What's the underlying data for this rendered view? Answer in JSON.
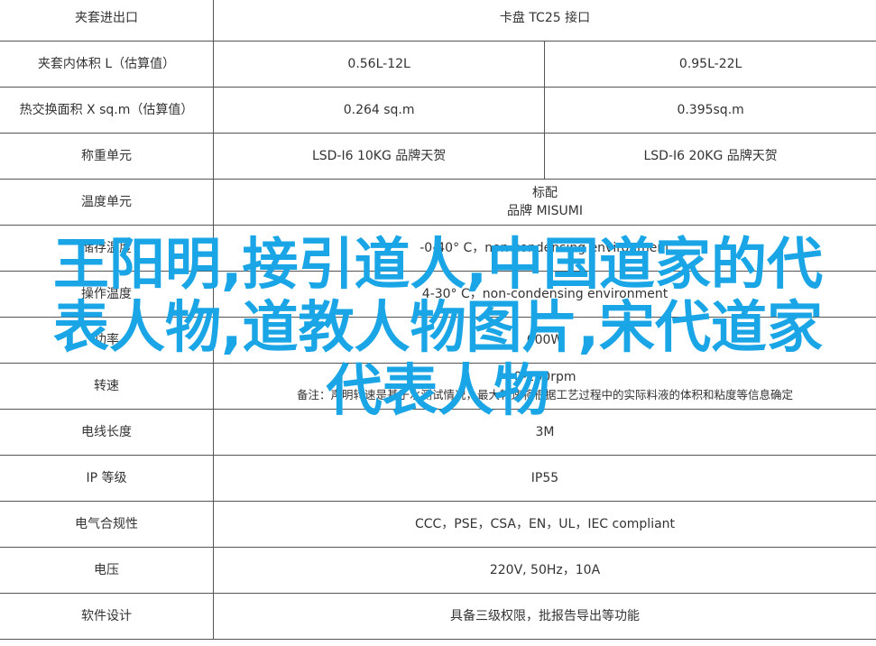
{
  "rows": [
    {
      "label": "夹套进出口",
      "value": "卡盘 TC25 接口"
    },
    {
      "label": "夹套内体积 L（估算值）",
      "col1": "0.56L-12L",
      "col2": "0.95L-22L"
    },
    {
      "label": "热交换面积 X sq.m（估算值）",
      "col1": "0.264 sq.m",
      "col2": "0.395sq.m"
    },
    {
      "label": "称重单元",
      "col1": "LSD-I6 10KG 品牌天贺",
      "col2": "LSD-I6 20KG 品牌天贺"
    },
    {
      "label": "温度单元",
      "line1": "标配",
      "line2": "品牌 MISUMI"
    },
    {
      "label": "储存温度",
      "value": "-0-40° C，non-condensing environment"
    },
    {
      "label": "操作温度",
      "value": "4-30° C，non-condensing environment"
    },
    {
      "label": "功率",
      "value": "600W"
    },
    {
      "label": "转速",
      "line1": "0-200rpm",
      "line2": "备注：声明转速是基于水测试情况，最大转速将根据工艺过程中的实际料液的体积和粘度等信息确定"
    },
    {
      "label": "电线长度",
      "value": "3M"
    },
    {
      "label": "IP 等级",
      "value": "IP55"
    },
    {
      "label": "电气合规性",
      "value": "CCC，PSE，CSA，EN，UL，IEC compliant"
    },
    {
      "label": "电压",
      "value": "220V, 50Hz，10A"
    },
    {
      "label": "软件设计",
      "value": "具备三级权限，批报告导出等功能"
    }
  ],
  "overlay": {
    "line1": "王阳明,接引道人,中国道家的代",
    "line2": "表人物,道教人物图片,宋代道家",
    "line3": "代表人物"
  },
  "colors": {
    "overlay": "#1aa6e6",
    "border": "#555555",
    "text": "#333333"
  }
}
